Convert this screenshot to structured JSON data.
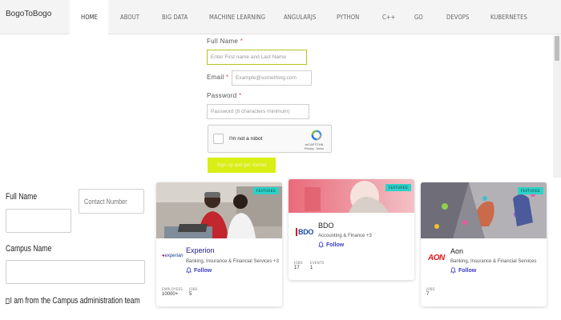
{
  "nav": {
    "brand": "BogoToBogo",
    "items": [
      {
        "label": "HOME"
      },
      {
        "label": "ABOUT"
      },
      {
        "label": "BIG DATA"
      },
      {
        "label": "MACHINE LEARNING"
      },
      {
        "label": "ANGULARJS"
      },
      {
        "label": "PYTHON"
      },
      {
        "label": "C++"
      },
      {
        "label": "GO"
      },
      {
        "label": "DEVOPS"
      },
      {
        "label": "KUBERNETES"
      }
    ]
  },
  "top_form": {
    "full_name_label": "Full Name",
    "full_name_placeholder": "Enter First name and Last Name",
    "email_label": "Email",
    "email_placeholder": "Example@something.com",
    "password_label": "Password",
    "password_placeholder": "Password (8 characters minimum)",
    "required_mark": "*",
    "captcha": {
      "text": "I'm not a robot",
      "brand": "reCAPTCHA",
      "links": "Privacy - Terms"
    },
    "submit_label": "Sign up and get started"
  },
  "left_form": {
    "full_name_label": "Full Name",
    "contact_placeholder": "Contact Number",
    "campus_label": "Campus Name",
    "admin_check_label": "I am from the Campus administration team"
  },
  "cards": [
    {
      "badge": "FEATURED",
      "name": "Experion",
      "logo_text": "experian",
      "industry": "Banking, Insurance & Financial Services +3",
      "follow": "Follow",
      "stats": [
        {
          "label": "EMPLOYEES",
          "value": "10000+"
        },
        {
          "label": "JOBS",
          "value": "5"
        }
      ]
    },
    {
      "badge": "FEATURED",
      "name": "BDO",
      "logo_text": "BDO",
      "industry": "Accounting & Finance +3",
      "follow": "Follow",
      "stats": [
        {
          "label": "JOBS",
          "value": "17"
        },
        {
          "label": "EVENTS",
          "value": "1"
        }
      ]
    },
    {
      "badge": "FEATURED",
      "name": "Aon",
      "logo_text": "AON",
      "industry": "Banking, Insurance & Financial Services",
      "follow": "Follow",
      "stats": [
        {
          "label": "JOBS",
          "value": "7"
        }
      ]
    }
  ],
  "colors": {
    "accent_lime": "#d9ee14",
    "featured_teal": "#2ed1c8",
    "follow_blue": "#3a3ac8",
    "experian_blue": "#1a1a8a",
    "bdo_blue": "#1f4aa8",
    "aon_red": "#e0141e"
  },
  "icons": {
    "bell": "bell-icon",
    "recaptcha": "recaptcha-logo-icon"
  }
}
